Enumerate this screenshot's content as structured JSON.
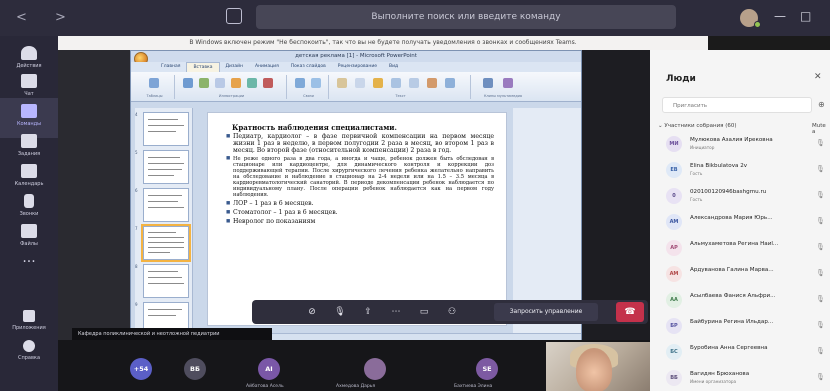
{
  "titlebar": {
    "nav": "< >",
    "search_placeholder": "Выполните поиск или введите команду",
    "window_controls": [
      "—",
      "□"
    ]
  },
  "rail": {
    "items": [
      {
        "label": "Действия",
        "icon": "bell-icon"
      },
      {
        "label": "Чат",
        "icon": "chat-icon"
      },
      {
        "label": "Команды",
        "icon": "teams-icon",
        "active": true
      },
      {
        "label": "Задания",
        "icon": "assignments-icon"
      },
      {
        "label": "Календарь",
        "icon": "calendar-icon"
      },
      {
        "label": "Звонки",
        "icon": "phone-icon"
      },
      {
        "label": "Файлы",
        "icon": "files-icon"
      }
    ],
    "more": "...",
    "bottom": [
      {
        "label": "Приложения",
        "icon": "apps-icon"
      },
      {
        "label": "Справка",
        "icon": "help-icon"
      }
    ]
  },
  "banner": "В Windows включен режим \"Не беспокоить\", так что вы не будете получать уведомления о звонках и сообщениях Teams.",
  "ppt": {
    "title": "детская реклама [1] - Microsoft PowerPoint",
    "tabs": [
      "Главная",
      "Вставка",
      "Дизайн",
      "Анимация",
      "Показ слайдов",
      "Рецензирование",
      "Вид"
    ],
    "active_tab": "Вставка",
    "ribbon_groups": [
      "Таблицы",
      "Иллюстрации",
      "Связи",
      "Текст",
      "Клипы мультимедиа"
    ],
    "status": "Слайд 7 из 10   \"Тема Office\"   русский (Россия)",
    "slide": {
      "title": "Кратность наблюдения специалистами.",
      "bullets": [
        "Педиатр, кардиолог – в фазе первичной компенсации на первом месяце жизни 1 раз в неделю, в первом полугодии 2 раза в месяц, во втором 1 раз в месяц. Во второй фазе (относительной компенсации) 2 раза в год.",
        "Не реже одного раза в два года, а иногда и чаще, ребенок должен быть обследован в стационаре или кардиоцентре, для динамического контроля и коррекции доз поддерживающей терапии. После хирургического лечения ребенка желательно направить на обследование и наблюдение в стационар на 2-4 недели или на 1.5 – 3.5 месяца в кардиоревматологический санаторий. В периоде декомпенсации ребенок наблюдается по индивидуальному плану. После операции ребенок наблюдается как на первом году наблюдения.",
        "ЛОР – 1 раз в 6 месяцев.",
        "Стоматолог – 1 раз в 6 месяцев.",
        "Невролог по показаниям"
      ],
      "notes_label": "Заметки к слайду"
    },
    "thumb_numbers": [
      "4",
      "5",
      "6",
      "7",
      "8",
      "9"
    ]
  },
  "presenter_label": "Кафедра поликлинической и неотложной педиатрии",
  "controls": {
    "request_control": "Запросить управление",
    "hangup_icon": "hangup-icon",
    "icons": [
      "camera-off-icon",
      "mic-icon",
      "share-icon",
      "more-icon",
      "chat-icon",
      "people-icon"
    ]
  },
  "gallery": [
    {
      "initials": "+54",
      "color": "#5b5fc7"
    },
    {
      "initials": "ВБ",
      "color": "#4f4d5e"
    },
    {
      "initials": "AI",
      "color": "#7a57a7",
      "name": "Айбатова Асель"
    },
    {
      "initials": "",
      "color": "#8a6c9a",
      "name": "Ахмедова Дарья"
    },
    {
      "initials": "SE",
      "color": "#7d5aa2",
      "name": "Бахтиева Элина"
    }
  ],
  "people": {
    "title": "Люди",
    "close": "✕",
    "invite_placeholder": "Пригласить",
    "section": "Участники собрания (60)",
    "mute_all": "Mute a",
    "participants": [
      {
        "initials": "МИ",
        "name": "Мулюкова Азалия Ирековна",
        "sub": "Инициатор",
        "bg": "#e6dff2",
        "fg": "#6b4f9a"
      },
      {
        "initials": "EB",
        "name": "Elina Bikbulatova 2v",
        "sub": "Гость",
        "bg": "#dfe9f7",
        "fg": "#3a62a8"
      },
      {
        "initials": "0",
        "name": "020100120946bashgmu.ru",
        "sub": "Гость",
        "bg": "#e8e2f4",
        "fg": "#5a4a8a"
      },
      {
        "initials": "АМ",
        "name": "Александрова Мария Юрь...",
        "sub": "",
        "bg": "#e0e6f7",
        "fg": "#3b56a0"
      },
      {
        "initials": "АР",
        "name": "Альмухаметова Регина Наиl...",
        "sub": "",
        "bg": "#f4e3ec",
        "fg": "#a04a74"
      },
      {
        "initials": "АМ",
        "name": "Ардуванова Галина Марва...",
        "sub": "",
        "bg": "#f6e3e3",
        "fg": "#b04646"
      },
      {
        "initials": "АА",
        "name": "Асылбаева Фанися Альфри...",
        "sub": "",
        "bg": "#e2f0e4",
        "fg": "#3f7a4b"
      },
      {
        "initials": "БР",
        "name": "Байбурина Регина Ильдар...",
        "sub": "",
        "bg": "#e6e3f4",
        "fg": "#5451a0"
      },
      {
        "initials": "БС",
        "name": "Буробина Анна Сергеевна",
        "sub": "",
        "bg": "#e2eef4",
        "fg": "#3f7389"
      },
      {
        "initials": "ВБ",
        "name": "Вагидян Брюханова",
        "sub": "Имени организатора",
        "bg": "#ece8f2",
        "fg": "#5c4d7a"
      }
    ]
  }
}
